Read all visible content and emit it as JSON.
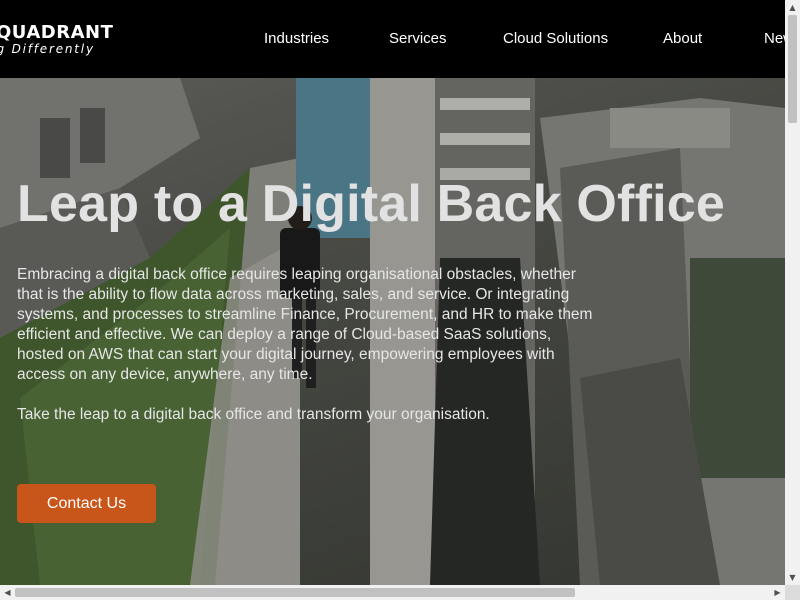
{
  "brand": {
    "name": "QUADRANT",
    "tagline": "ing Differently"
  },
  "nav": {
    "items": [
      {
        "label": "Industries"
      },
      {
        "label": "Services"
      },
      {
        "label": "Cloud Solutions"
      },
      {
        "label": "About"
      },
      {
        "label": "New"
      }
    ]
  },
  "hero": {
    "title": "Leap to a Digital Back Office",
    "paragraphs": [
      "Embracing a digital back office requires leaping organisational obstacles, whether that is the ability to flow data across marketing, sales, and service. Or integrating systems, and processes to streamline Finance, Procurement, and HR to make them efficient and effective. We can deploy a range of Cloud-based SaaS solutions, hosted on AWS that can start your digital journey,  empowering employees with access on any device, anywhere, any time.",
      "Take the leap to a digital back office and transform your organisation."
    ],
    "cta_label": "Contact Us"
  },
  "colors": {
    "header_bg": "#000000",
    "cta_bg": "#c8561a",
    "text": "#ffffff"
  },
  "scrollbars": {
    "up_arrow": "▲",
    "down_arrow": "▼",
    "left_arrow": "◀",
    "right_arrow": "▶"
  }
}
